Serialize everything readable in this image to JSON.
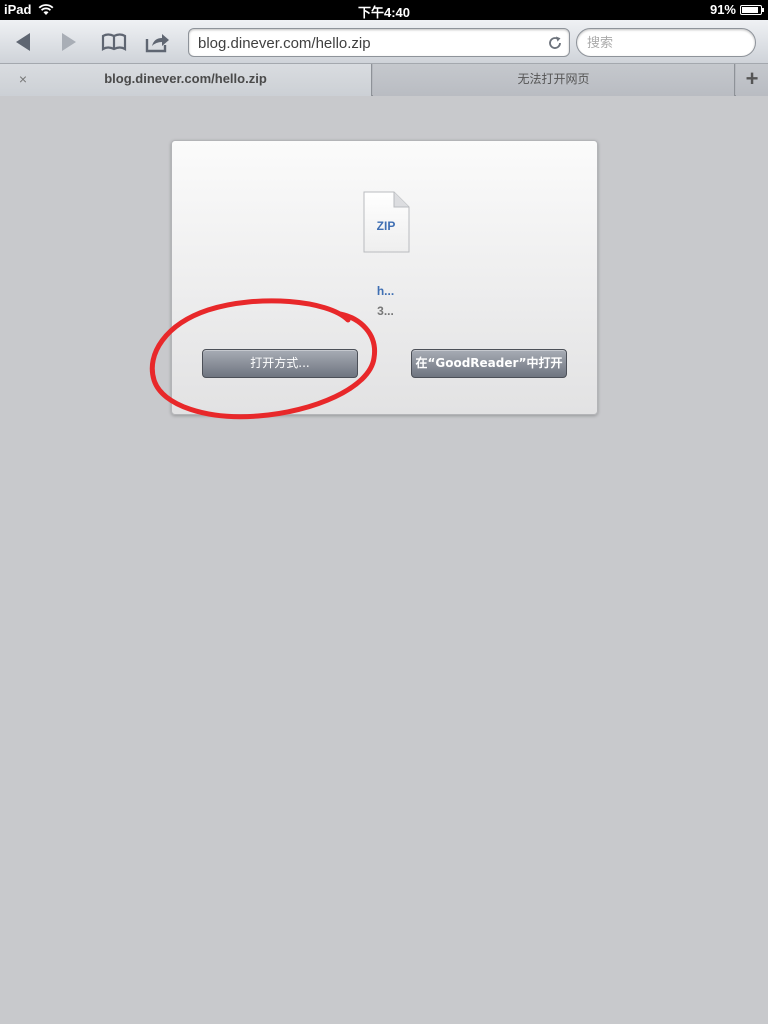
{
  "status_bar": {
    "carrier": "iPad",
    "time": "下午4:40",
    "battery_percent": "91%",
    "battery_level": 0.91
  },
  "toolbar": {
    "url": "blog.dinever.com/hello.zip",
    "search_placeholder": "搜索"
  },
  "tabs": [
    {
      "label": "blog.dinever.com/hello.zip",
      "close_symbol": "×",
      "active": true
    },
    {
      "label": "无法打开网页",
      "active": false
    }
  ],
  "new_tab_symbol": "+",
  "download": {
    "file_type": "ZIP",
    "file_name": "h...",
    "file_size": "3...",
    "open_with_label": "打开方式...",
    "open_in_label": "在“GoodReader”中打开"
  },
  "colors": {
    "annotation": "#e8282a",
    "link_blue": "#3f6fb3"
  }
}
